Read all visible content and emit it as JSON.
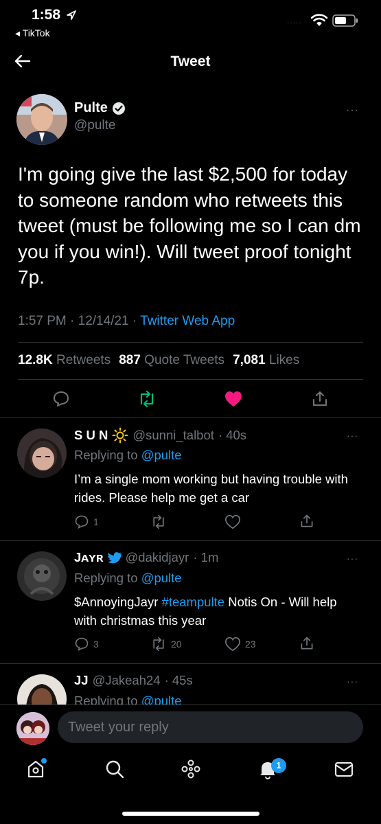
{
  "status_bar": {
    "time": "1:58",
    "back_app": "◂ TikTok",
    "signal": "·····"
  },
  "header": {
    "title": "Tweet"
  },
  "main_tweet": {
    "author_name": "Pulte",
    "author_handle": "@pulte",
    "more": "···",
    "text": "I'm going give the last $2,500 for today to someone random who retweets this tweet (must be following me so I can dm you if you win!). Will tweet proof tonight 7p.",
    "time": "1:57 PM · 12/14/21 · ",
    "source": "Twitter Web App",
    "retweets_count": "12.8K",
    "retweets_label": "Retweets",
    "quotes_count": "887",
    "quotes_label": "Quote Tweets",
    "likes_count": "7,081",
    "likes_label": "Likes"
  },
  "replies": [
    {
      "name": "S U N",
      "handle": "@sunni_talbot",
      "time": "· 40s",
      "replying_label": "Replying to",
      "replying_to": "@pulte",
      "text": "I’m a single mom working but having trouble with rides. Please help me get a car",
      "reply_count": "1",
      "retweet_count": "",
      "like_count": ""
    },
    {
      "name": "Jᴀʏʀ",
      "handle": "@dakidjayr",
      "time": "· 1m",
      "replying_label": "Replying to",
      "replying_to": "@pulte",
      "text_before": "$AnnoyingJayr ",
      "hashtag": "#teampulte",
      "text_after": " Notis On - Will help with christmas this year",
      "reply_count": "3",
      "retweet_count": "20",
      "like_count": "23"
    },
    {
      "name": "JJ",
      "handle": "@Jakeah24",
      "time": "· 45s",
      "replying_label": "Replying to",
      "replying_to": "@pulte"
    }
  ],
  "composer": {
    "placeholder": "Tweet your reply"
  },
  "tab_bar": {
    "notification_badge": "1"
  },
  "colors": {
    "accent": "#1d9bf0",
    "like": "#f91880",
    "retweet": "#00ba7c",
    "background": "#000000"
  }
}
